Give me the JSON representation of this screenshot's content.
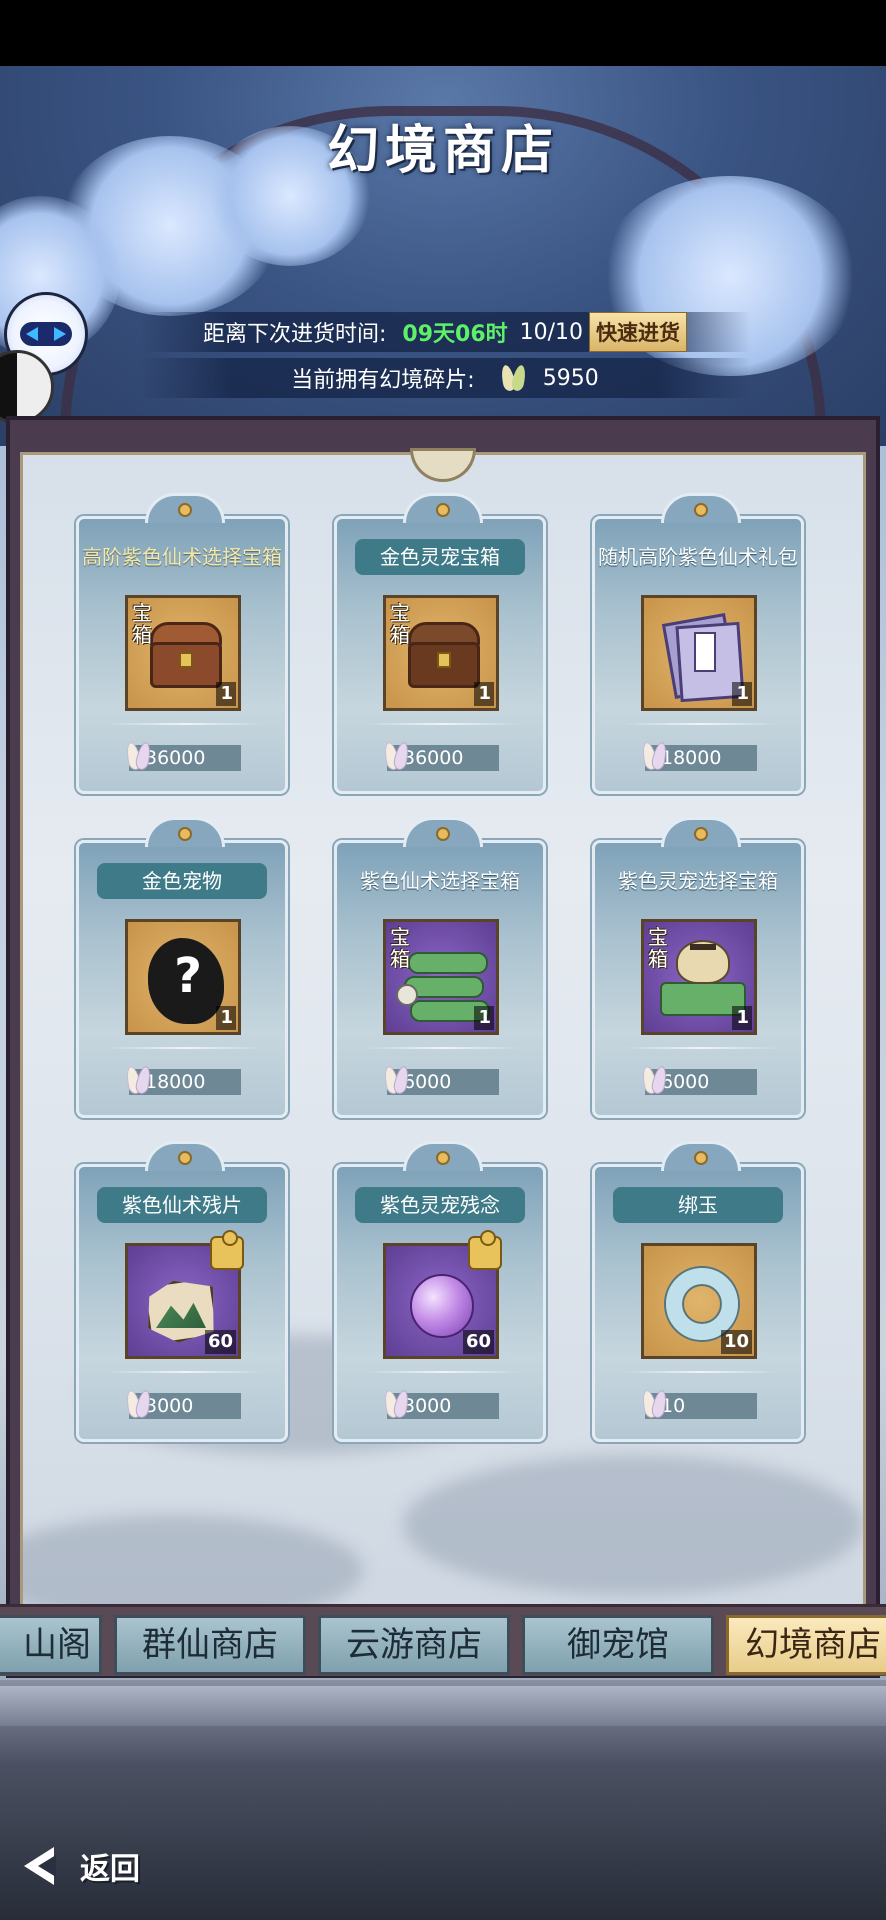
{
  "title": "幻境商店",
  "restock": {
    "label": "距离下次进货时间:",
    "time": "09天06时",
    "count": "10/10",
    "quick_button": "快速进货"
  },
  "shards": {
    "label": "当前拥有幻境碎片:",
    "icon": "shard-icon",
    "amount": "5950"
  },
  "items": [
    {
      "name": "高阶紫色仙术选择宝箱",
      "tag": "宝箱",
      "qty": "1",
      "price": "36000",
      "icon": "chest-icon"
    },
    {
      "name": "金色灵宠宝箱",
      "tag": "宝箱",
      "qty": "1",
      "price": "36000",
      "icon": "chest-icon"
    },
    {
      "name": "随机高阶紫色仙术礼包",
      "qty": "1",
      "price": "18000",
      "icon": "book-icon"
    },
    {
      "name": "金色宠物",
      "qty": "1",
      "price": "18000",
      "icon": "mystery-pet-icon"
    },
    {
      "name": "紫色仙术选择宝箱",
      "tag": "宝箱",
      "qty": "1",
      "price": "6000",
      "icon": "scroll-bundle-icon"
    },
    {
      "name": "紫色灵宠选择宝箱",
      "tag": "宝箱",
      "qty": "1",
      "price": "6000",
      "icon": "tiger-chest-icon"
    },
    {
      "name": "紫色仙术残片",
      "qty": "60",
      "price": "3000",
      "icon": "fragment-icon"
    },
    {
      "name": "紫色灵宠残念",
      "qty": "60",
      "price": "3000",
      "icon": "orb-icon"
    },
    {
      "name": "绑玉",
      "qty": "10",
      "price": "10",
      "icon": "jade-ring-icon"
    }
  ],
  "tabs": [
    "山阁",
    "群仙商店",
    "云游商店",
    "御宠馆",
    "幻境商店"
  ],
  "back": "返回",
  "colors": {
    "accent_green": "#5ff06a",
    "tab_active": "#fbe9bd",
    "price_bg": "#6e8896"
  }
}
